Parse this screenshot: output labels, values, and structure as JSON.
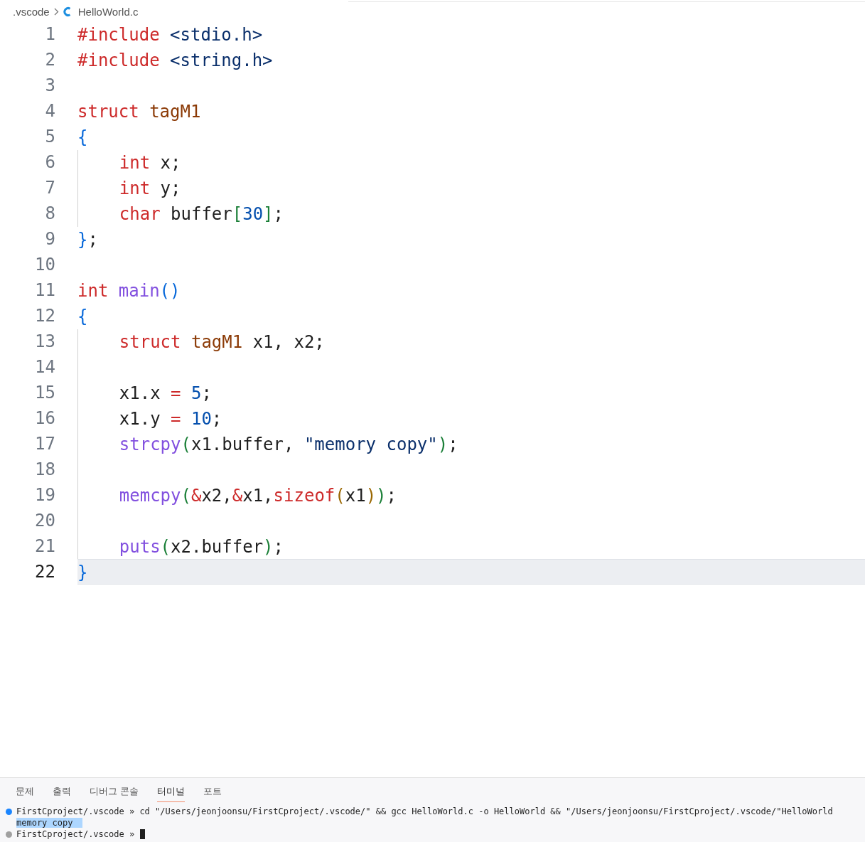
{
  "breadcrumb": {
    "folder": ".vscode",
    "file": "HelloWorld.c"
  },
  "editor": {
    "lines": [
      {
        "number": "1",
        "current": false,
        "indented": false,
        "tokens": [
          {
            "kind": "keyword",
            "text": "#include"
          },
          {
            "kind": "string",
            "text": " <stdio.h>"
          }
        ]
      },
      {
        "number": "2",
        "current": false,
        "indented": false,
        "tokens": [
          {
            "kind": "keyword",
            "text": "#include"
          },
          {
            "kind": "string",
            "text": " <string.h>"
          }
        ]
      },
      {
        "number": "3",
        "current": false,
        "indented": false
      },
      {
        "number": "4",
        "current": false,
        "indented": false,
        "tokens": [
          {
            "kind": "keyword",
            "text": "struct"
          },
          {
            "kind": "type",
            "text": " tagM1"
          }
        ]
      },
      {
        "number": "5",
        "current": false,
        "indented": false,
        "tokens": [
          {
            "kind": "bracket1",
            "text": "{"
          }
        ]
      },
      {
        "number": "6",
        "current": false,
        "indented": true,
        "tokens": [
          {
            "kind": "keyword",
            "text": "int"
          },
          {
            "kind": "plain",
            "text": " x;"
          }
        ]
      },
      {
        "number": "7",
        "current": false,
        "indented": true,
        "tokens": [
          {
            "kind": "keyword",
            "text": "int"
          },
          {
            "kind": "plain",
            "text": " y;"
          }
        ]
      },
      {
        "number": "8",
        "current": false,
        "indented": true,
        "tokens": [
          {
            "kind": "keyword",
            "text": "char"
          },
          {
            "kind": "plain",
            "text": " buffer"
          },
          {
            "kind": "bracket2",
            "text": "["
          },
          {
            "kind": "number",
            "text": "30"
          },
          {
            "kind": "bracket2",
            "text": "]"
          },
          {
            "kind": "plain",
            "text": ";"
          }
        ]
      },
      {
        "number": "9",
        "current": false,
        "indented": false,
        "tokens": [
          {
            "kind": "bracket1",
            "text": "}"
          },
          {
            "kind": "plain",
            "text": ";"
          }
        ]
      },
      {
        "number": "10",
        "current": false,
        "indented": false
      },
      {
        "number": "11",
        "current": false,
        "indented": false,
        "tokens": [
          {
            "kind": "keyword",
            "text": "int"
          },
          {
            "kind": "function",
            "text": " main"
          },
          {
            "kind": "bracket1",
            "text": "()"
          }
        ]
      },
      {
        "number": "12",
        "current": false,
        "indented": false,
        "tokens": [
          {
            "kind": "bracket1",
            "text": "{"
          }
        ]
      },
      {
        "number": "13",
        "current": false,
        "indented": true,
        "tokens": [
          {
            "kind": "keyword",
            "text": "struct"
          },
          {
            "kind": "type",
            "text": " tagM1"
          },
          {
            "kind": "plain",
            "text": " x1, x2;"
          }
        ]
      },
      {
        "number": "14",
        "current": false,
        "indented": true
      },
      {
        "number": "15",
        "current": false,
        "indented": true,
        "tokens": [
          {
            "kind": "plain",
            "text": "x1.x "
          },
          {
            "kind": "keyword",
            "text": "="
          },
          {
            "kind": "number",
            "text": " 5"
          },
          {
            "kind": "plain",
            "text": ";"
          }
        ]
      },
      {
        "number": "16",
        "current": false,
        "indented": true,
        "tokens": [
          {
            "kind": "plain",
            "text": "x1.y "
          },
          {
            "kind": "keyword",
            "text": "="
          },
          {
            "kind": "number",
            "text": " 10"
          },
          {
            "kind": "plain",
            "text": ";"
          }
        ]
      },
      {
        "number": "17",
        "current": false,
        "indented": true,
        "tokens": [
          {
            "kind": "function",
            "text": "strcpy"
          },
          {
            "kind": "bracket2",
            "text": "("
          },
          {
            "kind": "plain",
            "text": "x1.buffer, "
          },
          {
            "kind": "string",
            "text": "\"memory copy\""
          },
          {
            "kind": "bracket2",
            "text": ")"
          },
          {
            "kind": "plain",
            "text": ";"
          }
        ]
      },
      {
        "number": "18",
        "current": false,
        "indented": true
      },
      {
        "number": "19",
        "current": false,
        "indented": true,
        "tokens": [
          {
            "kind": "function",
            "text": "memcpy"
          },
          {
            "kind": "bracket2",
            "text": "("
          },
          {
            "kind": "keyword",
            "text": "&"
          },
          {
            "kind": "plain",
            "text": "x2,"
          },
          {
            "kind": "keyword",
            "text": "&"
          },
          {
            "kind": "plain",
            "text": "x1,"
          },
          {
            "kind": "keyword",
            "text": "sizeof"
          },
          {
            "kind": "bracket3",
            "text": "("
          },
          {
            "kind": "plain",
            "text": "x1"
          },
          {
            "kind": "bracket3",
            "text": ")"
          },
          {
            "kind": "bracket2",
            "text": ")"
          },
          {
            "kind": "plain",
            "text": ";"
          }
        ]
      },
      {
        "number": "20",
        "current": false,
        "indented": true
      },
      {
        "number": "21",
        "current": false,
        "indented": true,
        "tokens": [
          {
            "kind": "function",
            "text": "puts"
          },
          {
            "kind": "bracket2",
            "text": "("
          },
          {
            "kind": "plain",
            "text": "x2.buffer"
          },
          {
            "kind": "bracket2",
            "text": ")"
          },
          {
            "kind": "plain",
            "text": ";"
          }
        ]
      },
      {
        "number": "22",
        "current": true,
        "indented": false,
        "tokens": [
          {
            "kind": "bracket1",
            "text": "}"
          }
        ]
      }
    ]
  },
  "panel": {
    "tabs": [
      {
        "label": "문제",
        "selected": false
      },
      {
        "label": "출력",
        "selected": false
      },
      {
        "label": "디버그 콘솔",
        "selected": false
      },
      {
        "label": "터미널",
        "selected": true
      },
      {
        "label": "포트",
        "selected": false
      }
    ],
    "terminal": [
      {
        "color": "#1a85ff",
        "text": "FirstCproject/.vscode » cd \"/Users/jeonjoonsu/FirstCproject/.vscode/\" && gcc HelloWorld.c -o HelloWorld && \"/Users/jeonjoonsu/FirstCproject/.vscode/\"HelloWorld",
        "selected": false,
        "cursor": false
      },
      {
        "text": "memory copy",
        "selected": true,
        "cursor": false
      },
      {
        "color": "#a0a0a0",
        "text": "FirstCproject/.vscode »",
        "selected": false,
        "cursor": true
      }
    ]
  }
}
